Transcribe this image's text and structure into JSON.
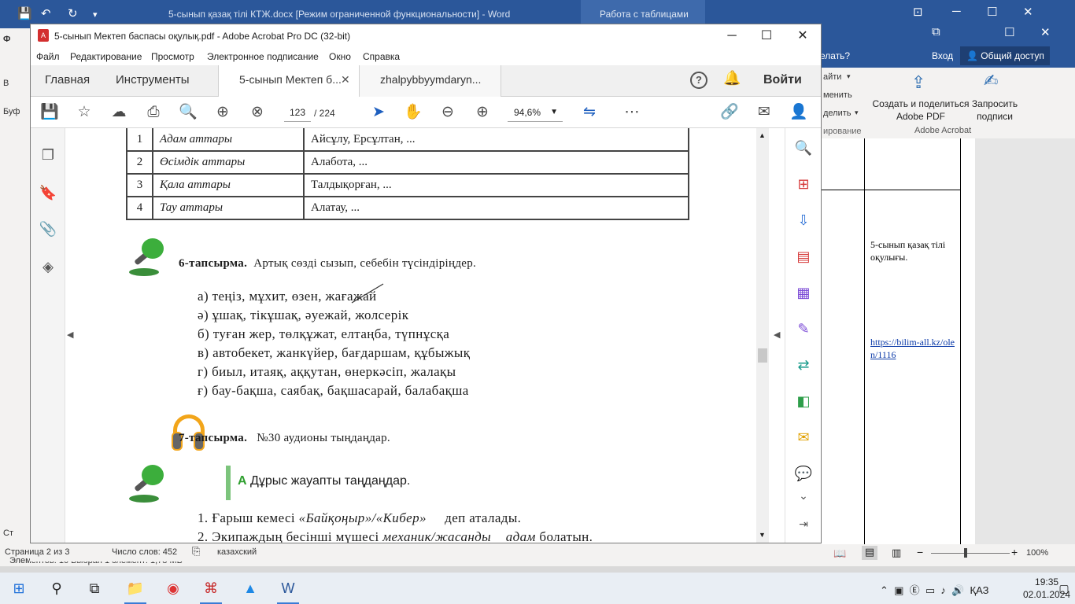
{
  "word": {
    "title": "5-сынып қазақ тілі КТЖ.docx [Режим ограниченной функциональности] - Word",
    "contextual_tab": "Работа с таблицами",
    "ask": "елать?",
    "login": "Вход",
    "share": "Общий доступ",
    "ribbon_small": [
      "айти",
      "менить",
      "делить",
      "ирование"
    ],
    "adobe_pdf": "Создать и поделиться Adobe PDF",
    "request_sign": "Запросить подписи",
    "adobe_group": "Adobe Acrobat",
    "left_strip": [
      "Ф",
      "В",
      "Буф",
      "Ст"
    ],
    "cell_text": "5-сынып қазақ тілі оқулығы.",
    "cell_link": "https://bilim-all.kz/olen/1116",
    "zoom": "100%",
    "explorer_info": "Элементов: 10     Выбран 1 элемент: 1,78 МБ"
  },
  "acrobat": {
    "title": "5-сынып Мектеп баспасы оқулық.pdf - Adobe Acrobat Pro DC (32-bit)",
    "menu": [
      "Файл",
      "Редактирование",
      "Просмотр",
      "Электронное подписание",
      "Окно",
      "Справка"
    ],
    "tabs": {
      "home": "Главная",
      "tools": "Инструменты",
      "doc1": "5-сынып Мектеп б...",
      "doc2": "zhalpybbyymdaryn..."
    },
    "login": "Войти",
    "page_current": "123",
    "page_total": "/ 224",
    "zoom": "94,6%"
  },
  "pdf": {
    "table": [
      {
        "n": "1",
        "name": "Адам аттары",
        "examples": "Айсұлу, Ерсұлтан, ..."
      },
      {
        "n": "2",
        "name": "Өсімдік аттары",
        "examples": "Алабота, ..."
      },
      {
        "n": "3",
        "name": "Қала аттары",
        "examples": "Талдықорған, ..."
      },
      {
        "n": "4",
        "name": "Тау аттары",
        "examples": "Алатау, ..."
      }
    ],
    "task6_label": "6-тапсырма.",
    "task6_text": "Артық сөзді сызып, себебін түсіндіріңдер.",
    "options": [
      "а) теңіз, мұхит, өзен, жағажай",
      "ә) ұшақ, тікұшақ, әуежай, жолсерік",
      "б) туған жер, төлқұжат, елтаңба, түпнұсқа",
      "в) автобекет, жанкүйер, бағдаршам, құбыжық",
      "г) биыл, итаяқ, аққутан, өнеркәсіп, жалақы",
      "ғ) бау-бақша, саябақ, бақшасарай, балабақша"
    ],
    "task7_label": "7-тапсырма.",
    "task7_text": "№30 аудионы тыңдаңдар.",
    "choose_a": "А",
    "choose_text": "Дұрыс жауапты таңдаңдар.",
    "q1": {
      "pre": "1. Ғарыш кемесі ",
      "it": "«Байқоңыр»/«Кибер»",
      "post": " деп аталады."
    },
    "q2": {
      "pre": "2. Экипаждың бесінші мүшесі ",
      "it": "механик/жасанды",
      "mid": " адам",
      "post": " болатын."
    }
  },
  "status": {
    "page": "Страница 2 из 3",
    "words": "Число слов: 452",
    "lang": "казахский"
  },
  "taskbar": {
    "time": "19:35",
    "date": "02.01.2024",
    "lang": "ҚАЗ"
  }
}
